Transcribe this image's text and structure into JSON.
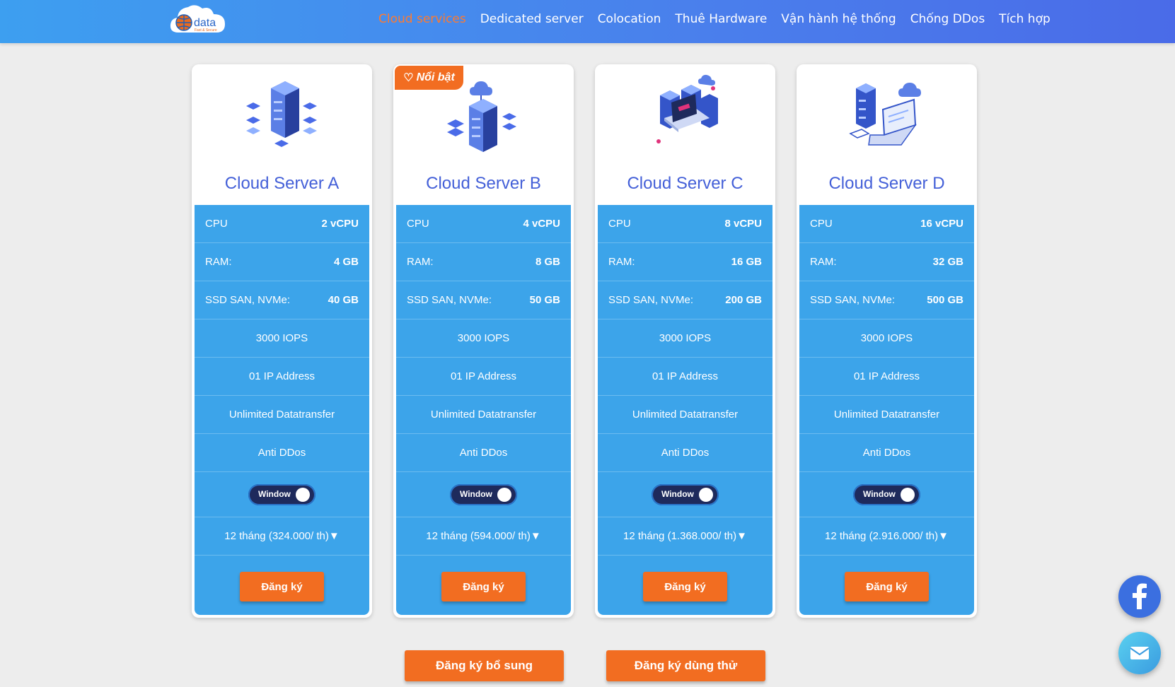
{
  "header": {
    "logo_text": "data",
    "logo_tagline": "Fast & Secure",
    "nav": [
      {
        "label": "Cloud services",
        "active": true
      },
      {
        "label": "Dedicated server",
        "active": false
      },
      {
        "label": "Colocation",
        "active": false
      },
      {
        "label": "Thuê Hardware",
        "active": false
      },
      {
        "label": "Vận hành hệ thống",
        "active": false
      },
      {
        "label": "Chống DDos",
        "active": false
      },
      {
        "label": "Tích hợp",
        "active": false
      }
    ]
  },
  "colors": {
    "header_gradient": [
      "#3d9ff0",
      "#4a6be8"
    ],
    "accent_orange": "#f26d21",
    "card_blue": "#3ca4ea",
    "title_blue": "#4460d8"
  },
  "featured_badge": "Nổi bật",
  "labels": {
    "cpu": "CPU",
    "ram": "RAM:",
    "ssd": "SSD SAN, NVMe:",
    "iops": "3000 IOPS",
    "ip": "01 IP Address",
    "transfer": "Unlimited Datatransfer",
    "ddos": "Anti DDos",
    "os_toggle": "Window",
    "register": "Đăng ký"
  },
  "plans": [
    {
      "name": "Cloud Server A",
      "cpu": "2 vCPU",
      "ram": "4 GB",
      "ssd": "40 GB",
      "price": "12 tháng (324.000/ th)▼",
      "featured": false
    },
    {
      "name": "Cloud Server B",
      "cpu": "4 vCPU",
      "ram": "8 GB",
      "ssd": "50 GB",
      "price": "12 tháng (594.000/ th)▼",
      "featured": true
    },
    {
      "name": "Cloud Server C",
      "cpu": "8 vCPU",
      "ram": "16 GB",
      "ssd": "200 GB",
      "price": "12 tháng (1.368.000/ th)▼",
      "featured": false
    },
    {
      "name": "Cloud Server D",
      "cpu": "16 vCPU",
      "ram": "32 GB",
      "ssd": "500 GB",
      "price": "12 tháng (2.916.000/ th)▼",
      "featured": false
    }
  ],
  "bottom_buttons": {
    "extra": "Đăng ký bổ sung",
    "trial": "Đăng ký dùng thử"
  },
  "icons": {
    "facebook": "facebook-icon",
    "mail": "mail-icon"
  }
}
